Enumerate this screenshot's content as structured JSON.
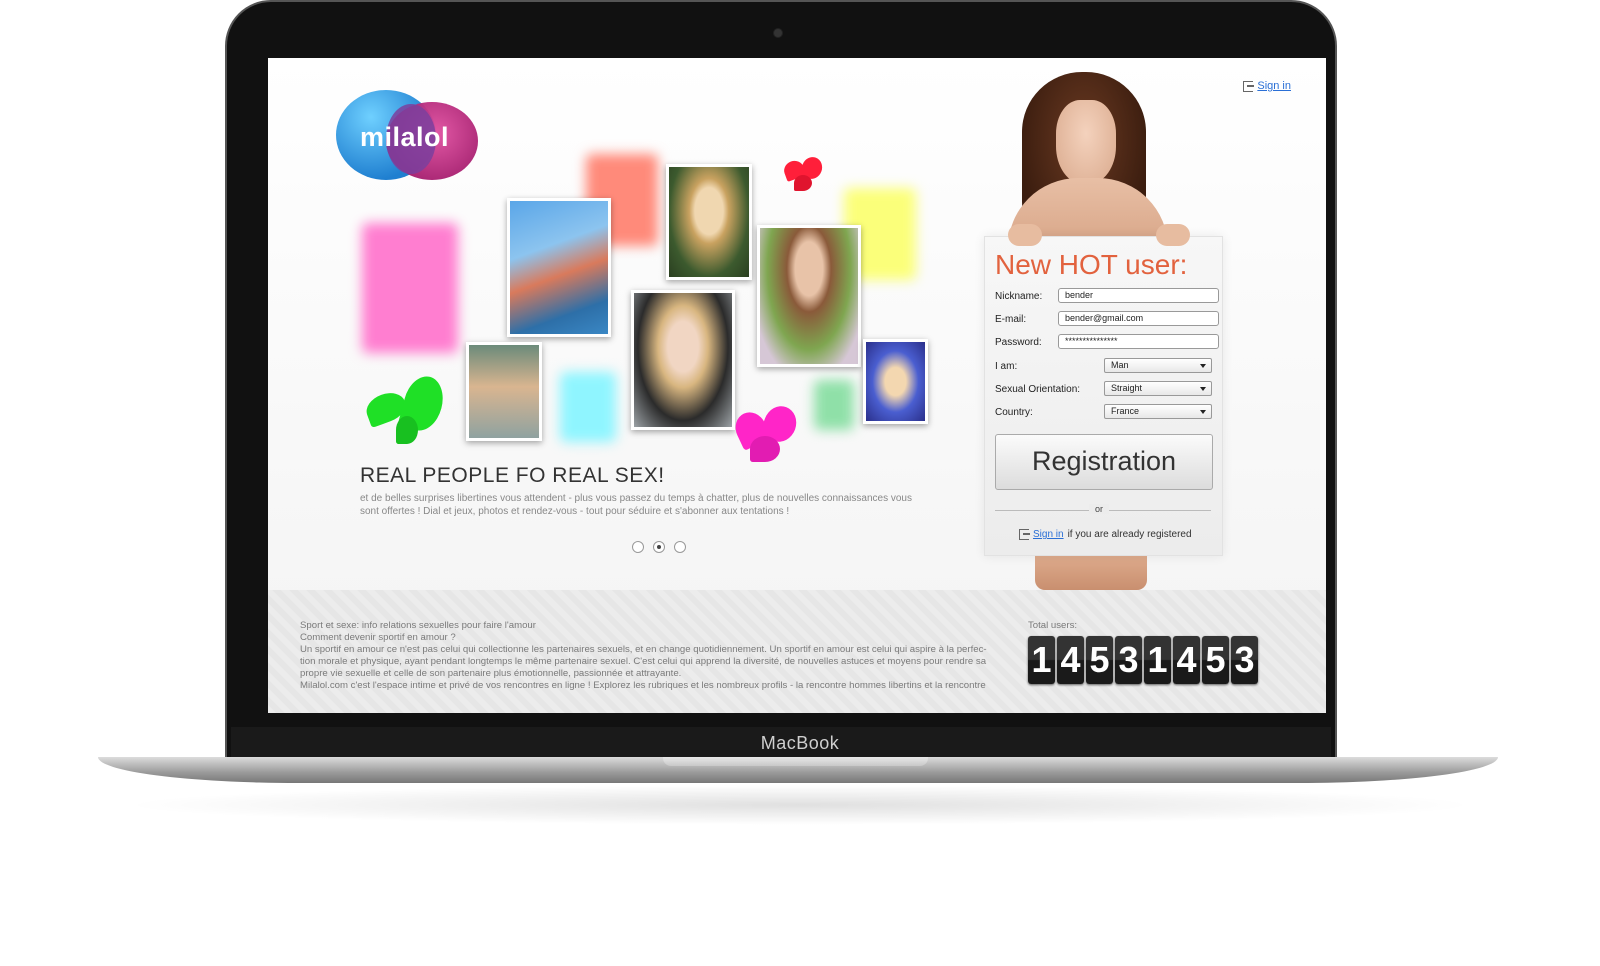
{
  "device": {
    "brand": "MacBook"
  },
  "page": {
    "logo_text": "milalol",
    "signin_top": "Sign in",
    "headline": "REAL PEOPLE FO REAL SEX!",
    "subtext": "et de belles surprises libertines vous attendent - plus vous passez du temps à chatter, plus de nouvelles connaissances vous sont offertes ! Dial et jeux, photos et rendez-vous - tout pour séduire et s'abonner aux tentations !",
    "slider": {
      "count": 3,
      "active_index": 1
    }
  },
  "registration": {
    "title": "New HOT user:",
    "fields": {
      "nickname_label": "Nickname:",
      "nickname_value": "bender",
      "email_label": "E-mail:",
      "email_value": "bender@gmail.com",
      "password_label": "Password:",
      "password_value": "***************",
      "iam_label": "I am:",
      "iam_value": "Man",
      "orientation_label": "Sexual Orientation:",
      "orientation_value": "Straight",
      "country_label": "Country:",
      "country_value": "France"
    },
    "button_label": "Registration",
    "or_label": "or",
    "signin_link": "Sign in",
    "signin_suffix": "if you are already registered"
  },
  "footer": {
    "lines": [
      "Sport et sexe: info relations sexuelles pour faire l'amour",
      "Comment devenir sportif en amour ?",
      "Un sportif en amour ce n'est pas celui qui collectionne les partenaires sexuels, et en change quotidiennement. Un sportif en amour est celui qui aspire à la perfec-",
      "tion morale et physique, ayant pendant longtemps le même partenaire sexuel. C'est celui qui apprend la diversité, de nouvelles astuces et moyens pour rendre sa",
      "propre vie sexuelle et celle de son partenaire plus émotionnelle, passionnée et attrayante.",
      "Milalol.com c'est l'espace intime et privé de vos rencontres en ligne ! Explorez les rubriques et les nombreux profils - la rencontre hommes libertins et la rencontre"
    ],
    "total_label": "Total users:",
    "total_digits": [
      "1",
      "4",
      "5",
      "3",
      "1",
      "4",
      "5",
      "3"
    ]
  },
  "colors": {
    "accent_title": "#e2623e",
    "link": "#2a6fd6"
  }
}
